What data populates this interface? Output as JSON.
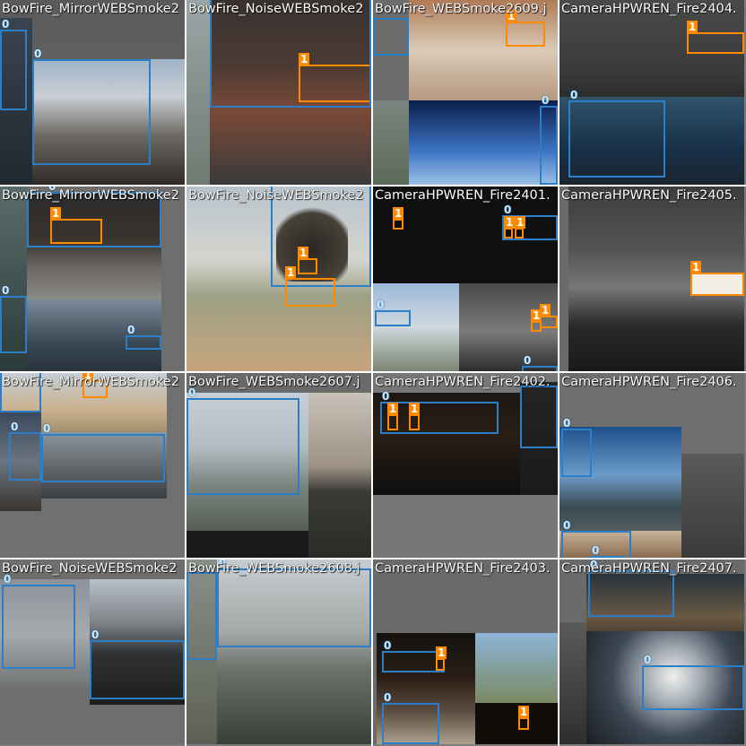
{
  "colors": {
    "smoke": "#2a7fc8",
    "fire": "#ff8a00"
  },
  "tiles": [
    {
      "title": "BowFire_MirrorWEBSmoke2",
      "labels": [
        "0",
        "0"
      ]
    },
    {
      "title": "BowFire_NoiseWEBSmoke2",
      "labels": [
        "1"
      ]
    },
    {
      "title": "BowFire_WEBSmoke2609.j",
      "labels": [
        "1",
        "0"
      ]
    },
    {
      "title": "CameraHPWREN_Fire2404.",
      "labels": [
        "1",
        "0"
      ]
    },
    {
      "title": "BowFire_MirrorWEBSmoke2",
      "labels": [
        "0",
        "1",
        "0",
        "0"
      ]
    },
    {
      "title": "BowFire_NoiseWEBSmoke2",
      "labels": [
        "0",
        "1",
        "1"
      ]
    },
    {
      "title": "CameraHPWREN_Fire2401.",
      "labels": [
        "1",
        "0",
        "1",
        "1",
        "0",
        "1",
        "1",
        "0"
      ]
    },
    {
      "title": "CameraHPWREN_Fire2405.",
      "labels": [
        "1"
      ]
    },
    {
      "title": "BowFire_MirrorWEBSmoke2",
      "labels": [
        "0",
        "1",
        "0",
        "0"
      ]
    },
    {
      "title": "BowFire_WEBSmoke2607.j",
      "labels": [
        "0"
      ]
    },
    {
      "title": "CameraHPWREN_Fire2402.",
      "labels": [
        "0",
        "1",
        "1"
      ]
    },
    {
      "title": "CameraHPWREN_Fire2406.",
      "labels": [
        "0",
        "0",
        "0"
      ]
    },
    {
      "title": "BowFire_NoiseWEBSmoke2",
      "labels": [
        "0",
        "0"
      ]
    },
    {
      "title": "BowFire_WEBSmoke2608.j",
      "labels": [
        "0"
      ]
    },
    {
      "title": "CameraHPWREN_Fire2403.",
      "labels": [
        "0",
        "1",
        "0",
        "1"
      ]
    },
    {
      "title": "CameraHPWREN_Fire2407.",
      "labels": [
        "0",
        "0"
      ]
    }
  ]
}
